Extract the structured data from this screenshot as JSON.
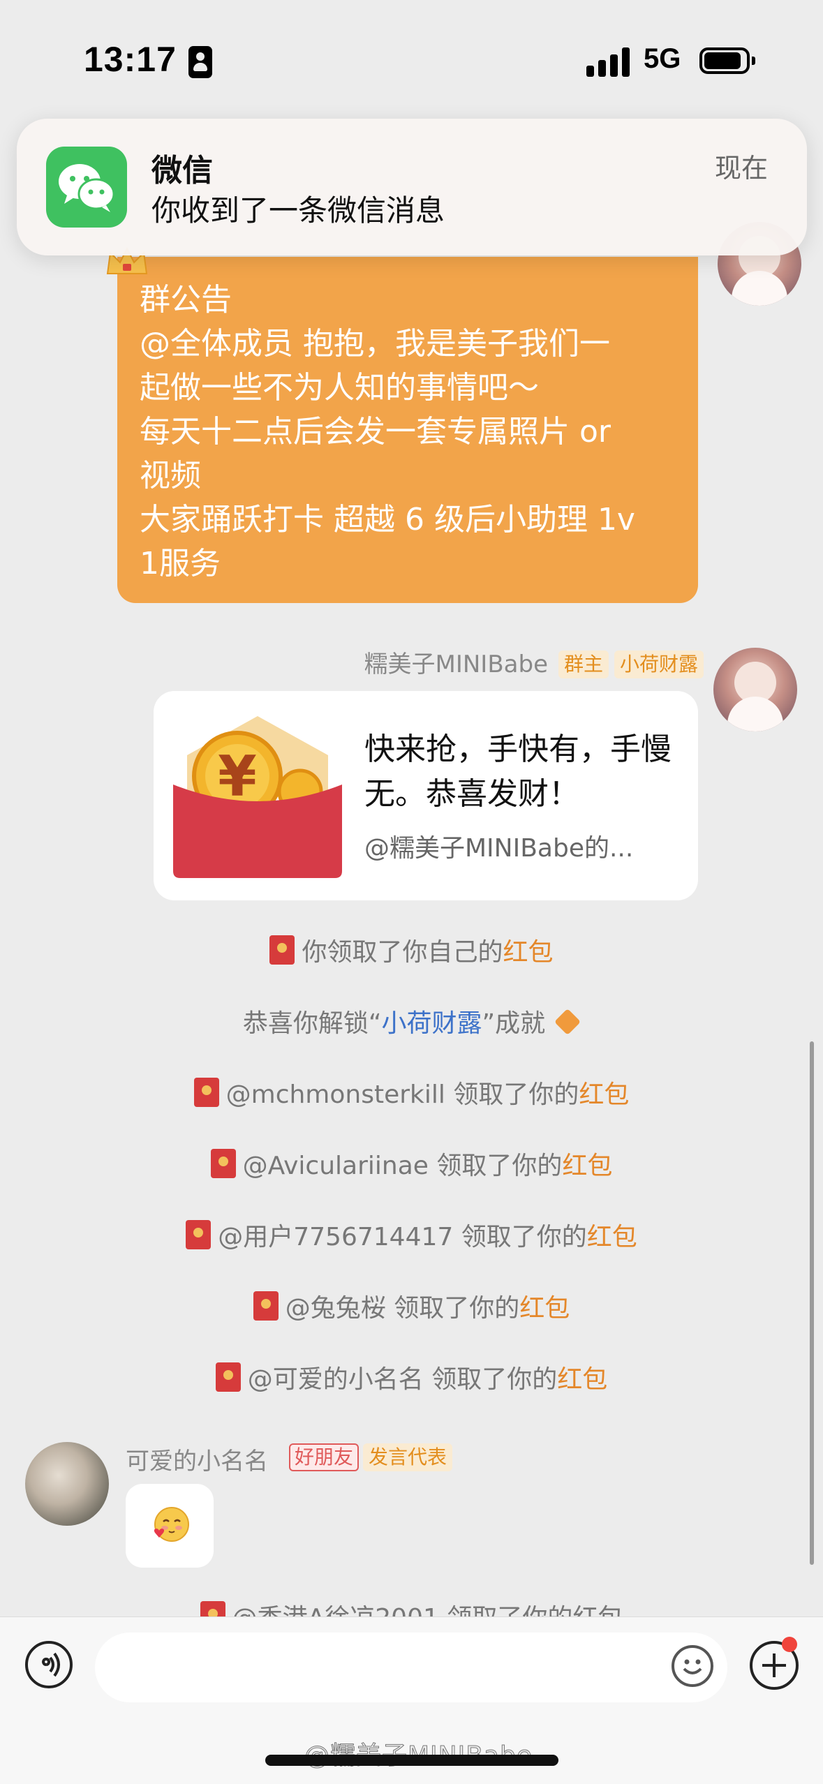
{
  "status_bar": {
    "time": "13:17",
    "network": "5G"
  },
  "notification": {
    "app_name": "微信",
    "message": "你收到了一条微信消息",
    "time": "现在",
    "app_color": "#3fc160"
  },
  "announcement": {
    "title": "群公告",
    "lines": [
      "@全体成员 抱抱，我是美子我们一",
      "起做一些不为人知的事情吧～",
      "每天十二点后会发一套专属照片 or",
      "视频",
      "大家踊跃打卡 超越 6 级后小助理 1v",
      "1服务"
    ],
    "background": "#f2a44a"
  },
  "host_message": {
    "sender": "糯美子MINIBabe",
    "badges": [
      "群主",
      "小荷财露"
    ],
    "red_packet": {
      "text": "快来抢，手快有，手慢无。恭喜发财！",
      "sender_line": "@糯美子MINIBabe的..."
    }
  },
  "system_messages": [
    {
      "prefix": "你领取了你自己的",
      "highlight": "红包"
    },
    {
      "prefix": "@mchmonsterkill 领取了你的",
      "highlight": "红包"
    },
    {
      "prefix": "@Aviculariinae 领取了你的",
      "highlight": "红包"
    },
    {
      "prefix": "@用户7756714417 领取了你的",
      "highlight": "红包"
    },
    {
      "prefix": "@兔兔桜 领取了你的",
      "highlight": "红包"
    },
    {
      "prefix": "@可爱的小名名 领取了你的",
      "highlight": "红包"
    }
  ],
  "achievement": {
    "before": "恭喜你解锁“",
    "name": "小荷财露",
    "after": "”成就"
  },
  "friend_message": {
    "sender": "可爱的小名名",
    "badges": [
      "好朋友",
      "发言代表"
    ],
    "content_icon": "blushing-heart-emoji"
  },
  "partial_message": "@香港A徐凉2001 领取了你的红包",
  "input_bar": {
    "placeholder": ""
  },
  "watermark": "@糯美子MINIBabe",
  "colors": {
    "highlight_orange": "#e4872a",
    "link_blue": "#3d72c9",
    "red_packet": "#d63b3b",
    "badge_text": "#e38e1e"
  }
}
